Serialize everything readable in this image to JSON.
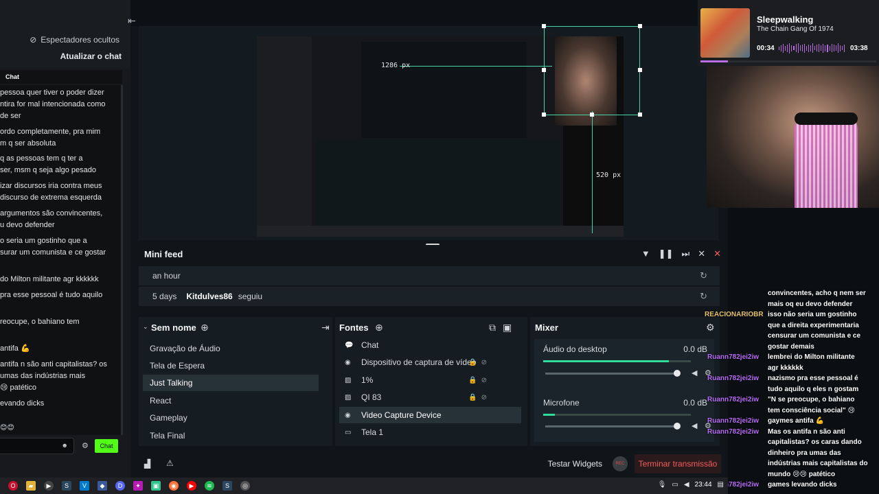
{
  "chat_panel": {
    "hidden_viewers": "Espectadores ocultos",
    "refresh_chat": "Atualizar o chat",
    "header": "Chat",
    "lines": [
      "pessoa quer tiver o poder dizer",
      "ntira for mal intencionada como",
      "de ser",
      "ordo completamente, pra mim",
      "m q ser absoluta",
      "q as pessoas tem q ter a",
      "ser, msm q seja algo pesado",
      "izar discursos iria contra meus",
      "discurso de extrema esquerda",
      "argumentos são convincentes,",
      "u devo defender",
      "o seria um gostinho que a",
      "surar um comunista e ce gostar",
      "do Milton militante agr kkkkkk",
      "pra esse pessoal é tudo aquilo",
      "reocupe, o bahiano tem",
      "antifa 💪",
      "antifa n são anti capitalistas? os",
      "umas das indústrias mais",
      "😢 patético",
      "evando dicks"
    ],
    "send_label": "Chat",
    "emotes": "😊😊"
  },
  "preview": {
    "width_label": "1286 px",
    "height_label": "520 px"
  },
  "mini_feed": {
    "title": "Mini feed",
    "rows": [
      {
        "when": "an hour",
        "who": "",
        "what": ""
      },
      {
        "when": "5 days",
        "who": "Kitdulves86",
        "what": "seguiu"
      }
    ]
  },
  "scenes": {
    "title": "Sem nome",
    "items": [
      "Gravação de Áudio",
      "Tela de Espera",
      "Just Talking",
      "React",
      "Gameplay",
      "Tela Final"
    ],
    "active": "Just Talking"
  },
  "sources": {
    "title": "Fontes",
    "items": [
      {
        "label": "Chat",
        "icon": "chat-icon"
      },
      {
        "label": "Dispositivo de captura de vídeo",
        "icon": "webcam-icon"
      },
      {
        "label": "1%",
        "icon": "image-icon"
      },
      {
        "label": "QI 83",
        "icon": "image-icon"
      },
      {
        "label": "Video Capture Device",
        "icon": "webcam-icon"
      },
      {
        "label": "Tela 1",
        "icon": "monitor-icon"
      }
    ],
    "active": "Video Capture Device"
  },
  "mixer": {
    "title": "Mixer",
    "channels": [
      {
        "label": "Áudio do desktop",
        "db": "0.0 dB",
        "level": 0.85
      },
      {
        "label": "Microfone",
        "db": "0.0 dB",
        "level": 0.08
      }
    ]
  },
  "bottom": {
    "test_widgets": "Testar Widgets",
    "rec": "REC",
    "end_stream": "Terminar transmissão"
  },
  "now_playing": {
    "title": "Sleepwalking",
    "artist": "The Chain Gang Of 1974",
    "elapsed": "00:34",
    "duration": "03:38",
    "progress": 0.155
  },
  "overlay_chat": {
    "lines": [
      {
        "user": "",
        "text": "convincentes, acho q nem ser"
      },
      {
        "user": "",
        "text": "mais oq eu devo defender"
      },
      {
        "user": "REACIONARIOBR",
        "text": "isso não seria um gostinho"
      },
      {
        "user": "",
        "text": "que a direita experimentaria"
      },
      {
        "user": "",
        "text": "censurar um comunista e ce"
      },
      {
        "user": "",
        "text": "gostar demais"
      },
      {
        "user": "Ruann782jei2iw",
        "text": "lembrei do Milton militante"
      },
      {
        "user": "",
        "text": "agr kkkkkk"
      },
      {
        "user": "Ruann782jei2iw",
        "text": "nazismo pra esse pessoal é"
      },
      {
        "user": "",
        "text": "tudo aquilo q eles n gostam"
      },
      {
        "user": "Ruann782jei2iw",
        "text": "\"N se preocupe, o bahiano"
      },
      {
        "user": "",
        "text": "tem consciência social\" 😢"
      },
      {
        "user": "Ruann782jei2iw",
        "text": "gaymes antifa 💪"
      },
      {
        "user": "Ruann782jei2iw",
        "text": "Mas os antifa n são anti"
      },
      {
        "user": "",
        "text": "capitalistas? os caras dando"
      },
      {
        "user": "",
        "text": "dinheiro pra umas das"
      },
      {
        "user": "",
        "text": "indústrias mais capitalistas do"
      },
      {
        "user": "",
        "text": "mundo 😢😢 patético"
      },
      {
        "user": "Ruann782jei2iw",
        "text": "games levando dicks"
      }
    ]
  },
  "taskbar": {
    "time": "23:44"
  }
}
